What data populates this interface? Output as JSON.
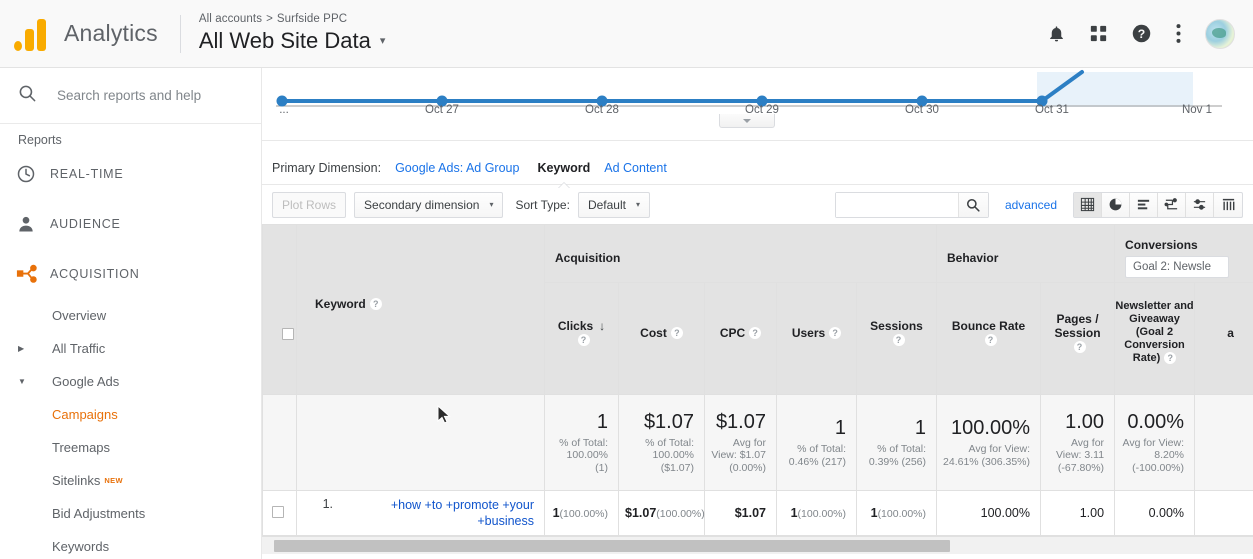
{
  "header": {
    "brand": "Analytics",
    "breadcrumb_root": "All accounts",
    "breadcrumb_sep": ">",
    "breadcrumb_account": "Surfside PPC",
    "view_title": "All Web Site Data",
    "view_caret": "▾",
    "icons": [
      "bell-icon",
      "apps-grid-icon",
      "help-icon",
      "more-vert-icon",
      "avatar"
    ]
  },
  "sidebar": {
    "search_placeholder": "Search reports and help",
    "search_value": "",
    "reports_label": "Reports",
    "sections": [
      {
        "label": "REAL-TIME",
        "icon": "clock-icon"
      },
      {
        "label": "AUDIENCE",
        "icon": "person-icon"
      },
      {
        "label": "ACQUISITION",
        "icon": "acquisition-icon"
      }
    ],
    "acquisition_items": [
      {
        "label": "Overview",
        "arrow": "",
        "selected": false,
        "badge": ""
      },
      {
        "label": "All Traffic",
        "arrow": "▶",
        "selected": false,
        "badge": ""
      },
      {
        "label": "Google Ads",
        "arrow": "▼",
        "selected": false,
        "badge": ""
      },
      {
        "label": "Campaigns",
        "arrow": "",
        "selected": true,
        "badge": ""
      },
      {
        "label": "Treemaps",
        "arrow": "",
        "selected": false,
        "badge": ""
      },
      {
        "label": "Sitelinks",
        "arrow": "",
        "selected": false,
        "badge": "NEW"
      },
      {
        "label": "Bid Adjustments",
        "arrow": "",
        "selected": false,
        "badge": ""
      },
      {
        "label": "Keywords",
        "arrow": "",
        "selected": false,
        "badge": ""
      }
    ]
  },
  "chart_data": {
    "type": "line",
    "title": "",
    "xlabel": "",
    "ylabel": "",
    "categories": [
      "...",
      "Oct 27",
      "Oct 28",
      "Oct 29",
      "Oct 30",
      "Oct 31",
      "Nov 1"
    ],
    "x_tick_labels": [
      "...",
      "Oct 27",
      "Oct 28",
      "Oct 29",
      "Oct 30",
      "Oct 31",
      "Nov 1"
    ],
    "series": [
      {
        "name": "Clicks",
        "values": [
          0,
          0,
          0,
          0,
          0,
          0,
          1
        ],
        "color": "#1f77c4"
      }
    ],
    "markers": [
      true,
      true,
      true,
      true,
      true,
      true,
      false
    ],
    "grid": false,
    "legend": "none",
    "highlight_band": {
      "from": "Oct 31",
      "to": "Nov 1",
      "color": "#e8f2fa"
    },
    "line_color": "#2c7fc4",
    "marker_color": "#2c7fc4",
    "collapse_control": "▼"
  },
  "primary_dimension": {
    "label": "Primary Dimension:",
    "options": [
      {
        "label": "Google Ads: Ad Group",
        "active": false
      },
      {
        "label": "Keyword",
        "active": true
      },
      {
        "label": "Ad Content",
        "active": false
      }
    ]
  },
  "toolbar": {
    "plot_rows": "Plot Rows",
    "secondary_dimension": "Secondary dimension",
    "sort_type_label": "Sort Type:",
    "sort_type_value": "Default",
    "caret": "▾",
    "search_value": "",
    "search_placeholder": "",
    "advanced": "advanced",
    "view_icons": [
      {
        "name": "table-view-icon",
        "selected": true
      },
      {
        "name": "pie-view-icon",
        "selected": false
      },
      {
        "name": "percent-bar-view-icon",
        "selected": false
      },
      {
        "name": "performance-view-icon",
        "selected": false
      },
      {
        "name": "comparison-view-icon",
        "selected": false
      },
      {
        "name": "pivot-view-icon",
        "selected": false
      }
    ]
  },
  "table": {
    "group_headers": [
      {
        "label": "Acquisition",
        "span": 5
      },
      {
        "label": "Behavior",
        "span": 2
      },
      {
        "label": "Conversions",
        "span": 2,
        "goal_select": "Goal 2: Newsle"
      }
    ],
    "columns": [
      {
        "label": "Keyword",
        "help": "?",
        "align": "left"
      },
      {
        "label": "Clicks",
        "help": "?",
        "sort": "↓"
      },
      {
        "label": "Cost",
        "help": "?"
      },
      {
        "label": "CPC",
        "help": "?"
      },
      {
        "label": "Users",
        "help": "?"
      },
      {
        "label": "Sessions",
        "help": "?"
      },
      {
        "label": "Bounce Rate",
        "help": "?"
      },
      {
        "label": "Pages / Session",
        "help": "?"
      },
      {
        "label": "Newsletter and Giveaway (Goal 2 Conversion Rate)",
        "help": "?"
      },
      {
        "label": "a",
        "help": ""
      }
    ],
    "summary_row": [
      {
        "main": "1",
        "sub": "% of Total: 100.00% (1)"
      },
      {
        "main": "$1.07",
        "sub": "% of Total: 100.00% ($1.07)"
      },
      {
        "main": "$1.07",
        "sub": "Avg for View: $1.07 (0.00%)"
      },
      {
        "main": "1",
        "sub": "% of Total: 0.46% (217)"
      },
      {
        "main": "1",
        "sub": "% of Total: 0.39% (256)"
      },
      {
        "main": "100.00%",
        "sub": "Avg for View: 24.61% (306.35%)"
      },
      {
        "main": "1.00",
        "sub": "Avg for View: 3.11 (-67.80%)"
      },
      {
        "main": "0.00%",
        "sub": "Avg for View: 8.20% (-100.00%)"
      }
    ],
    "rows": [
      {
        "index": "1.",
        "keyword": "+how +to +promote +your +business",
        "clicks": "1",
        "clicks_pct": "(100.00%)",
        "cost": "$1.07",
        "cost_pct": "(100.00%)",
        "cpc": "$1.07",
        "users": "1",
        "users_pct": "(100.00%)",
        "sessions": "1",
        "sessions_pct": "(100.00%)",
        "bounce_rate": "100.00%",
        "pages_session": "1.00",
        "goal2_rate": "0.00%"
      }
    ]
  },
  "colors": {
    "accent_orange": "#e8710a",
    "link_blue": "#1a73e8",
    "keyword_link": "#1155cc",
    "chart_blue": "#2c7fc4",
    "header_gray": "#e3e3e3"
  }
}
